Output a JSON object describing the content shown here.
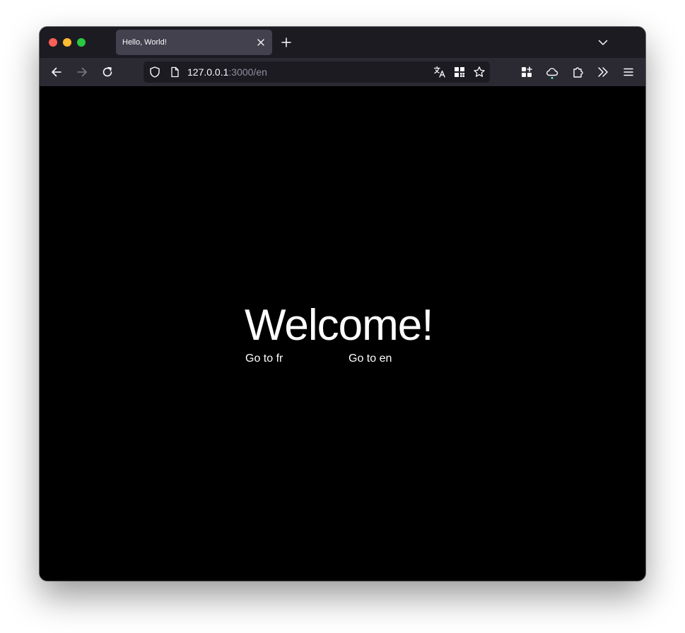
{
  "browser": {
    "tabs": [
      {
        "title": "Hello, World!",
        "active": true
      }
    ],
    "url": {
      "host": "127.0.0.1",
      "rest": ":3000/en"
    }
  },
  "page": {
    "heading": "Welcome!",
    "links": [
      {
        "label": "Go to fr"
      },
      {
        "label": "Go to en"
      }
    ]
  },
  "icons": {
    "back": "arrow-left-icon",
    "forward": "arrow-right-icon",
    "reload": "reload-icon",
    "shield": "shield-icon",
    "page": "page-icon",
    "translate": "translate-icon",
    "qr": "qr-code-icon",
    "bookmark": "star-icon",
    "extensions": "puzzle-icon",
    "sync": "cloud-icon",
    "overflow": "double-chevron-icon",
    "menu": "hamburger-icon"
  },
  "colors": {
    "accent": "#54ffbd",
    "content_bg": "#000000",
    "tab_active_bg": "#42414d",
    "toolbar_bg": "#2b2a33",
    "tabstrip_bg": "#1c1b22"
  }
}
